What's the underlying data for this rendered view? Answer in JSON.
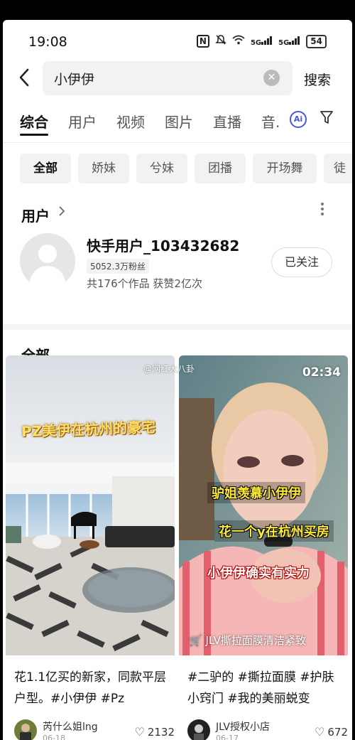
{
  "status_bar": {
    "time": "19:08",
    "nfc": "N",
    "signal1": "5G",
    "signal2": "5G",
    "battery": "54"
  },
  "search": {
    "value": "小伊伊",
    "button_label": "搜索"
  },
  "tabs": [
    {
      "label": "综合",
      "active": true
    },
    {
      "label": "用户"
    },
    {
      "label": "视频"
    },
    {
      "label": "图片"
    },
    {
      "label": "直播"
    },
    {
      "label": "音."
    }
  ],
  "ai_label": "Ai",
  "chips": [
    "全部",
    "娇妹",
    "兮妹",
    "团播",
    "开场舞",
    "徒"
  ],
  "user_section": {
    "title": "用户",
    "user": {
      "name": "快手用户_103432682",
      "fans": "5052.3万粉丝",
      "stats": "共176个作品 获赞2亿次",
      "follow_label": "已关注"
    }
  },
  "all_title": "全部",
  "watermark": "@网红大八卦",
  "cards": [
    {
      "overlay": "PZ美伊在杭州的豪宅",
      "desc": "花1.1亿买的新家，同款平层户型。#小伊伊 #Pz",
      "author": "芮什么姐lng",
      "date": "06-18",
      "likes": "2132"
    },
    {
      "duration": "02:34",
      "overlay_lines": [
        "驴姐羡慕小伊伊",
        "花一个y在杭州买房",
        "小伊伊确实有实力"
      ],
      "shop": "JLV撕拉面膜清洁紧致",
      "desc": "#二驴的 #撕拉面膜 #护肤小窍门 #我的美丽蜕变",
      "author": "JLV授权小店",
      "date": "06-17",
      "likes": "672"
    }
  ]
}
